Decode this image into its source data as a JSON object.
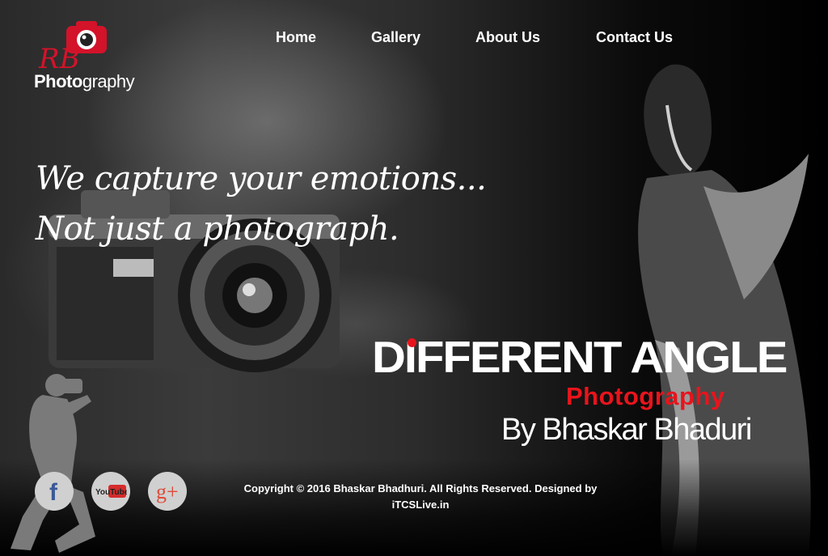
{
  "logo": {
    "bold": "Photo",
    "regular": "graphy",
    "initials": "RB"
  },
  "nav": {
    "items": [
      {
        "label": "Home"
      },
      {
        "label": "Gallery"
      },
      {
        "label": "About Us"
      },
      {
        "label": "Contact Us"
      }
    ]
  },
  "hero": {
    "line1": "We capture your emotions...",
    "line2": "Not just a photograph."
  },
  "brand": {
    "title": "DIFFERENT ANGLE",
    "subtitle": "Photography",
    "by": "By Bhaskar Bhaduri"
  },
  "social": [
    {
      "icon": "facebook-icon",
      "label": "f"
    },
    {
      "icon": "youtube-icon",
      "label": "YouTube"
    },
    {
      "icon": "google-plus-icon",
      "label": "g+"
    }
  ],
  "footer": {
    "line1": "Copyright © 2016 Bhaskar Bhadhuri. All Rights Reserved. Designed by",
    "line2": "iTCSLive.in"
  },
  "colors": {
    "accent": "#e8141c",
    "background": "#050505",
    "social_bg": "#d0d0d0"
  }
}
